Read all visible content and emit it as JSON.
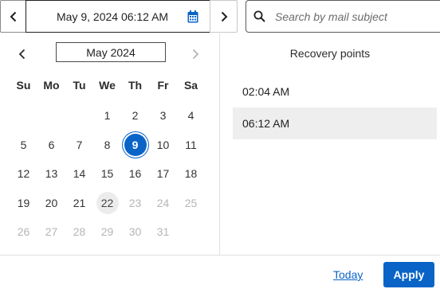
{
  "toolbar": {
    "date_value": "May 9, 2024 06:12 AM",
    "search_placeholder": "Search by mail subject",
    "icons": {
      "prev": "chevron-left-icon",
      "next": "chevron-right-icon",
      "calendar": "calendar-icon",
      "search": "search-icon"
    }
  },
  "calendar": {
    "month_label": "May 2024",
    "weekdays": [
      "Su",
      "Mo",
      "Tu",
      "We",
      "Th",
      "Fr",
      "Sa"
    ],
    "leading_blanks": 3,
    "days": [
      {
        "n": "1",
        "state": "normal"
      },
      {
        "n": "2",
        "state": "normal"
      },
      {
        "n": "3",
        "state": "normal"
      },
      {
        "n": "4",
        "state": "normal"
      },
      {
        "n": "5",
        "state": "normal"
      },
      {
        "n": "6",
        "state": "normal"
      },
      {
        "n": "7",
        "state": "normal"
      },
      {
        "n": "8",
        "state": "normal"
      },
      {
        "n": "9",
        "state": "selected"
      },
      {
        "n": "10",
        "state": "normal"
      },
      {
        "n": "11",
        "state": "normal"
      },
      {
        "n": "12",
        "state": "normal"
      },
      {
        "n": "13",
        "state": "normal"
      },
      {
        "n": "14",
        "state": "normal"
      },
      {
        "n": "15",
        "state": "normal"
      },
      {
        "n": "16",
        "state": "normal"
      },
      {
        "n": "17",
        "state": "normal"
      },
      {
        "n": "18",
        "state": "normal"
      },
      {
        "n": "19",
        "state": "normal"
      },
      {
        "n": "20",
        "state": "normal"
      },
      {
        "n": "21",
        "state": "normal"
      },
      {
        "n": "22",
        "state": "today"
      },
      {
        "n": "23",
        "state": "disabled"
      },
      {
        "n": "24",
        "state": "disabled"
      },
      {
        "n": "25",
        "state": "disabled"
      },
      {
        "n": "26",
        "state": "disabled"
      },
      {
        "n": "27",
        "state": "disabled"
      },
      {
        "n": "28",
        "state": "disabled"
      },
      {
        "n": "29",
        "state": "disabled"
      },
      {
        "n": "30",
        "state": "disabled"
      },
      {
        "n": "31",
        "state": "disabled"
      }
    ]
  },
  "recovery": {
    "title": "Recovery points",
    "points": [
      {
        "time": "02:04 AM",
        "active": false
      },
      {
        "time": "06:12 AM",
        "active": true
      }
    ]
  },
  "footer": {
    "today_label": "Today",
    "apply_label": "Apply"
  },
  "colors": {
    "accent": "#0a64c8",
    "today_bg": "#ececec",
    "active_row_bg": "#eeeeee",
    "disabled_text": "#b5b5b5"
  }
}
